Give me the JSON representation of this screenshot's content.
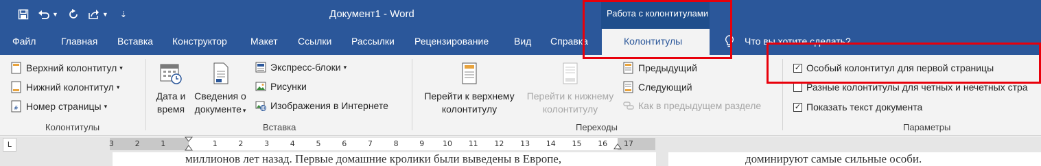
{
  "window": {
    "title": "Документ1  -  Word",
    "context_group": "Работа с колонтитулами"
  },
  "tabs": [
    {
      "label": "Файл"
    },
    {
      "label": "Главная"
    },
    {
      "label": "Вставка"
    },
    {
      "label": "Конструктор"
    },
    {
      "label": "Макет"
    },
    {
      "label": "Ссылки"
    },
    {
      "label": "Рассылки"
    },
    {
      "label": "Рецензирование"
    },
    {
      "label": "Вид"
    },
    {
      "label": "Справка"
    }
  ],
  "active_tab": "Колонтитулы",
  "tell_me": "Что вы хотите сделать?",
  "groups": {
    "headers": {
      "label": "Колонтитулы",
      "items": [
        "Верхний колонтитул",
        "Нижний колонтитул",
        "Номер страницы"
      ]
    },
    "insert": {
      "label": "Вставка",
      "date_time": [
        "Дата и",
        "время"
      ],
      "doc_info": [
        "Сведения о",
        "документе"
      ],
      "items": [
        "Экспресс-блоки",
        "Рисунки",
        "Изображения в Интернете"
      ]
    },
    "navigation": {
      "label": "Переходы",
      "goto_header": [
        "Перейти к верхнему",
        "колонтитулу"
      ],
      "goto_footer": [
        "Перейти к нижнему",
        "колонтитулу"
      ],
      "items": [
        "Предыдущий",
        "Следующий",
        "Как в предыдущем разделе"
      ]
    },
    "options": {
      "label": "Параметры",
      "checkboxes": [
        {
          "label": "Особый колонтитул для первой страницы",
          "checked": true
        },
        {
          "label": "Разные колонтитулы для четных и нечетных стра",
          "checked": false
        },
        {
          "label": "Показать текст документа",
          "checked": true
        }
      ]
    }
  },
  "ruler": {
    "corner": "L",
    "numbers": [
      "3",
      "2",
      "1",
      "1",
      "2",
      "3",
      "4",
      "5",
      "6",
      "7",
      "8",
      "9",
      "10",
      "11",
      "12",
      "13",
      "14",
      "15",
      "16",
      "17"
    ]
  },
  "document": {
    "page1_text": "миллионов лет назад. Первые домашние кролики были выведены в Европе,",
    "page2_text": "доминируют самые сильные особи."
  },
  "colors": {
    "accent": "#2b579a",
    "highlight": "#e8000b"
  }
}
